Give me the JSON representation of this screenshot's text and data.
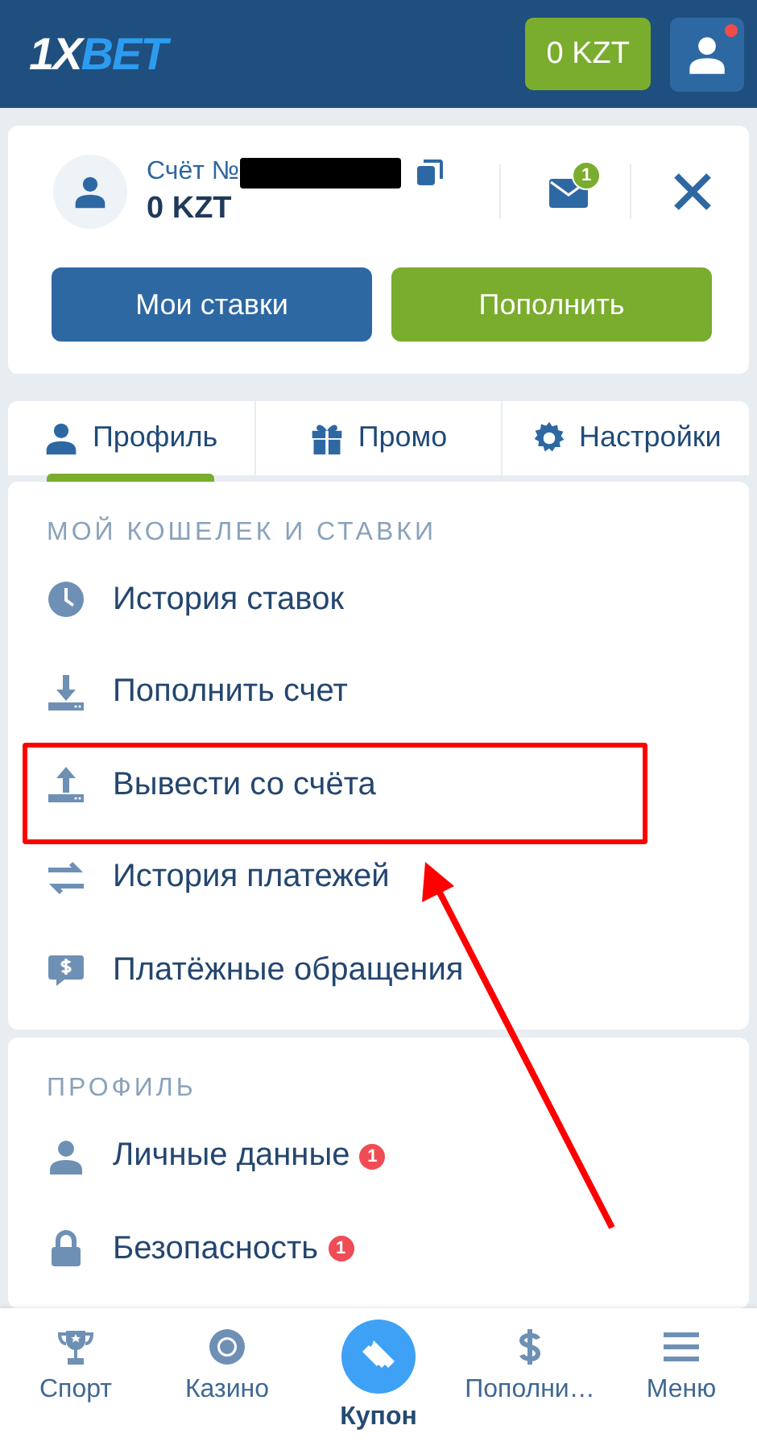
{
  "header": {
    "logo": {
      "part1": "1X",
      "part2": "BET"
    },
    "balance": "0 KZT",
    "alert": true
  },
  "account": {
    "label": "Счёт №",
    "number_redacted": true,
    "balance": "0 KZT",
    "messages_badge": "1",
    "buttons": [
      {
        "label": "Мои ставки",
        "kind": "primary"
      },
      {
        "label": "Пополнить",
        "kind": "accent"
      }
    ]
  },
  "tabs": [
    {
      "label": "Профиль",
      "kind": "user",
      "selected": true
    },
    {
      "label": "Промо",
      "kind": "gift",
      "selected": false
    },
    {
      "label": "Настройки",
      "kind": "gear",
      "selected": false
    }
  ],
  "sections": [
    {
      "title": "МОЙ КОШЕЛЕК И СТАВКИ",
      "items": [
        {
          "label": "История ставок",
          "kind": "clock",
          "highlighted": false
        },
        {
          "label": "Пополнить счет",
          "kind": "download",
          "highlighted": false
        },
        {
          "label": "Вывести со счёта",
          "kind": "upload",
          "highlighted": true
        },
        {
          "label": "История платежей",
          "kind": "transfer",
          "highlighted": false
        },
        {
          "label": "Платёжные обращения",
          "kind": "chat",
          "highlighted": false
        }
      ]
    },
    {
      "title": "ПРОФИЛЬ",
      "items": [
        {
          "label": "Личные данные",
          "kind": "user",
          "badge": "1",
          "highlighted": false
        },
        {
          "label": "Безопасность",
          "kind": "lock",
          "badge": "1",
          "highlighted": false
        }
      ]
    }
  ],
  "annotation_arrow": true,
  "bottom_nav": [
    {
      "label": "Спорт",
      "kind": "trophy",
      "selected": false
    },
    {
      "label": "Казино",
      "kind": "chip",
      "selected": false
    },
    {
      "label": "Купон",
      "kind": "ticket",
      "selected": true
    },
    {
      "label": "Пополни…",
      "kind": "dollar",
      "selected": false
    },
    {
      "label": "Меню",
      "kind": "menu",
      "selected": false
    }
  ]
}
